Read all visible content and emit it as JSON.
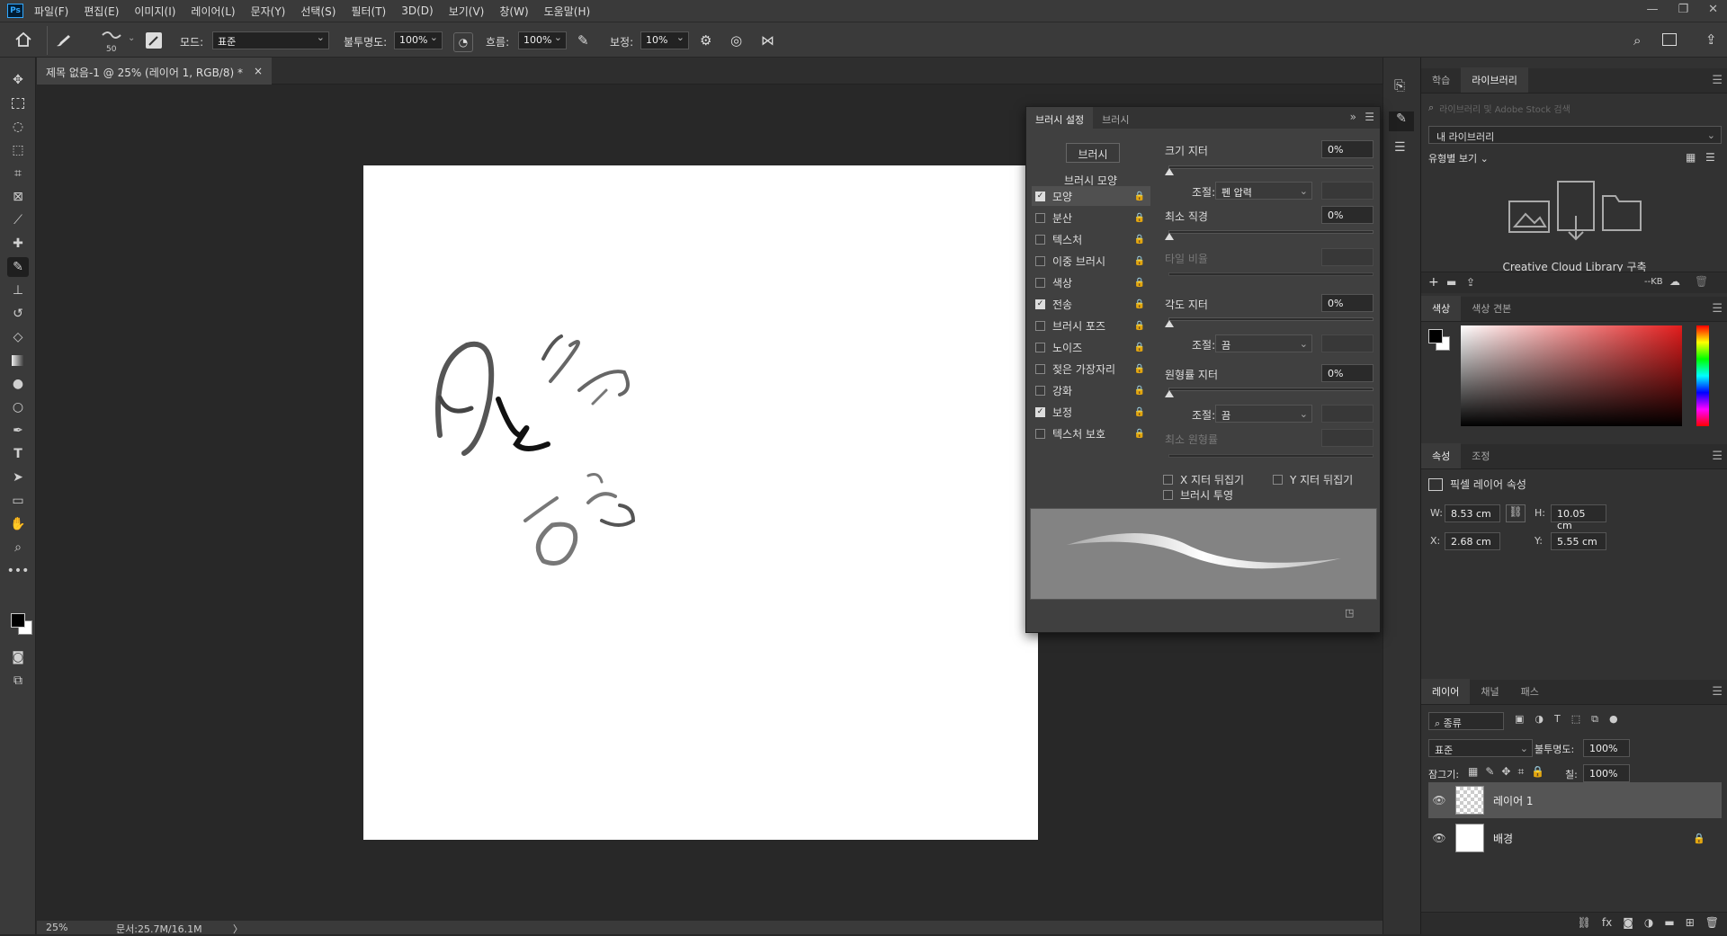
{
  "menubar": {
    "logo": "Ps",
    "items": [
      "파일(F)",
      "편집(E)",
      "이미지(I)",
      "레이어(L)",
      "문자(Y)",
      "선택(S)",
      "필터(T)",
      "3D(D)",
      "보기(V)",
      "창(W)",
      "도움말(H)"
    ],
    "window_controls": [
      "—",
      "❐",
      "✕"
    ]
  },
  "options": {
    "brush_size": "50",
    "mode_label": "모드:",
    "mode_value": "표준",
    "opacity_label": "불투명도:",
    "opacity_value": "100%",
    "flow_label": "흐름:",
    "flow_value": "100%",
    "smoothing_label": "보정:",
    "smoothing_value": "10%"
  },
  "document": {
    "tab_title": "제목 없음-1 @ 25% (레이어 1, RGB/8) *",
    "close": "×",
    "zoom": "25%",
    "doc_size": "문서:25.7M/16.1M",
    "status_arrow": "〉"
  },
  "brush_panel": {
    "tabs": [
      "브러시 설정",
      "브러시"
    ],
    "brushes_button": "브러시",
    "section_title": "브러시 모양",
    "items": [
      {
        "label": "모양",
        "checked": true,
        "active": true
      },
      {
        "label": "분산",
        "checked": false
      },
      {
        "label": "텍스처",
        "checked": false
      },
      {
        "label": "이중 브러시",
        "checked": false
      },
      {
        "label": "색상",
        "checked": false
      },
      {
        "label": "전송",
        "checked": true
      },
      {
        "label": "브러시 포즈",
        "checked": false
      },
      {
        "label": "노이즈",
        "checked": false
      },
      {
        "label": "젖은 가장자리",
        "checked": false
      },
      {
        "label": "강화",
        "checked": false
      },
      {
        "label": "보정",
        "checked": true
      },
      {
        "label": "텍스처 보호",
        "checked": false
      }
    ],
    "size_jitter_label": "크기 지터",
    "size_jitter_value": "0%",
    "control_label": "조절:",
    "control_pen": "펜 압력",
    "min_diameter_label": "최소 직경",
    "min_diameter_value": "0%",
    "tilt_scale_label": "타일 비율",
    "angle_jitter_label": "각도 지터",
    "angle_jitter_value": "0%",
    "control_off": "끔",
    "roundness_jitter_label": "원형률 지터",
    "roundness_jitter_value": "0%",
    "min_roundness_label": "최소 원형률",
    "flip_x": "X 지터 뒤집기",
    "flip_y": "Y 지터 뒤집기",
    "brush_projection": "브러시 투영"
  },
  "libraries": {
    "tabs": [
      "학습",
      "라이브러리"
    ],
    "search_placeholder": "라이브러리 및 Adobe Stock 검색",
    "my_library": "내 라이브러리",
    "view_by_type": "유형별 보기",
    "cc_text": "Creative Cloud Library 구축",
    "kb": "--KB"
  },
  "color": {
    "tabs": [
      "색상",
      "색상 견본"
    ],
    "accent": "#e31c1c"
  },
  "properties": {
    "tabs": [
      "속성",
      "조정"
    ],
    "title": "픽셀 레이어 속성",
    "w_label": "W:",
    "w_value": "8.53 cm",
    "h_label": "H:",
    "h_value": "10.05 cm",
    "x_label": "X:",
    "x_value": "2.68 cm",
    "y_label": "Y:",
    "y_value": "5.55 cm"
  },
  "layers": {
    "tabs": [
      "레이어",
      "채널",
      "패스"
    ],
    "filter_kind": "종류",
    "blend_mode": "표준",
    "opacity_label": "불투명도:",
    "opacity_value": "100%",
    "lock_label": "잠그기:",
    "fill_label": "칠:",
    "fill_value": "100%",
    "items": [
      {
        "name": "레이어 1",
        "selected": true
      },
      {
        "name": "배경",
        "locked": true
      }
    ]
  }
}
